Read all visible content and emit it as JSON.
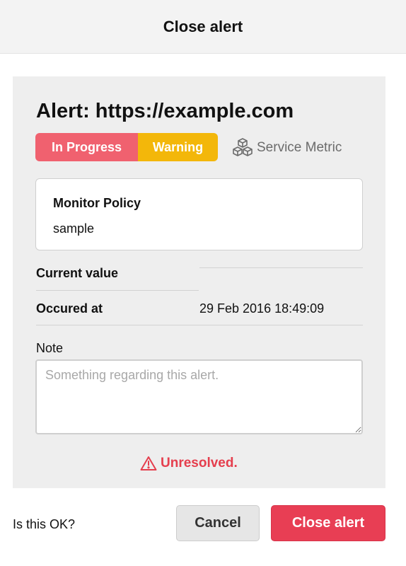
{
  "header": {
    "title": "Close alert"
  },
  "alert": {
    "title": "Alert: https://example.com",
    "status": "In Progress",
    "level": "Warning",
    "type": "Service Metric",
    "type_icon": "cubes-icon"
  },
  "policy": {
    "heading": "Monitor Policy",
    "value": "sample"
  },
  "details": {
    "current_value_label": "Current value",
    "current_value": "",
    "occurred_at_label": "Occured at",
    "occurred_at": "29 Feb 2016 18:49:09"
  },
  "note": {
    "label": "Note",
    "placeholder": "Something regarding this alert.",
    "value": ""
  },
  "resolution": {
    "text": "Unresolved.",
    "icon": "warning-icon"
  },
  "footer": {
    "question": "Is this OK?",
    "cancel_label": "Cancel",
    "confirm_label": "Close alert"
  },
  "colors": {
    "status_in_progress": "#f0616f",
    "level_warning": "#f3b70a",
    "unresolved": "#e53e4d",
    "primary_button": "#e83e54",
    "panel_background": "#eeeeee"
  }
}
